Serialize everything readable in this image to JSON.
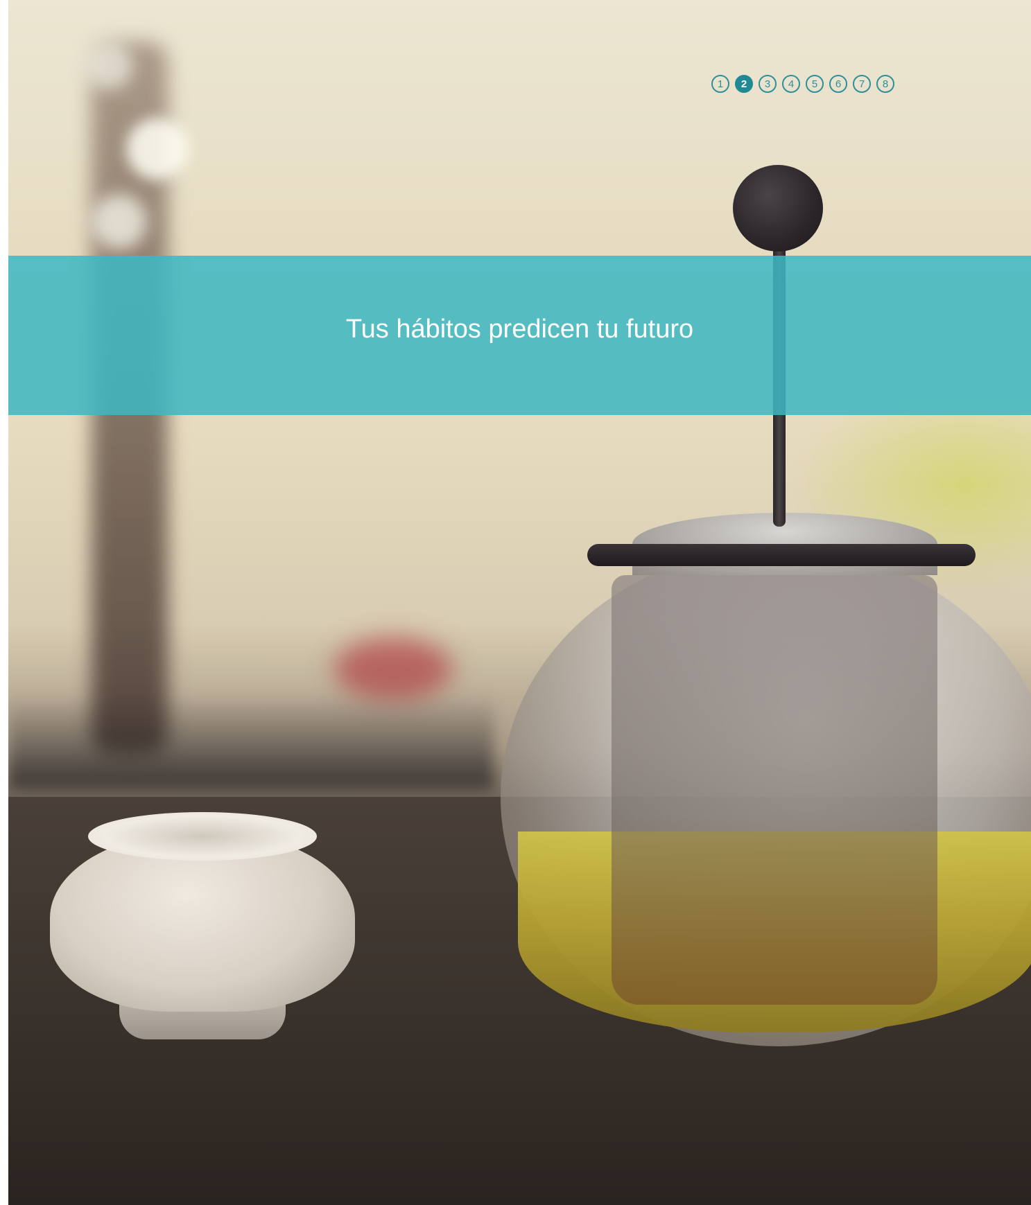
{
  "banner": {
    "title": "Tus hábitos predicen tu futuro"
  },
  "pager": {
    "pages": [
      "1",
      "2",
      "3",
      "4",
      "5",
      "6",
      "7",
      "8"
    ],
    "active_page": "2"
  },
  "colors": {
    "banner_teal": "#3cb8c2",
    "pager_teal": "#1f8a94"
  }
}
